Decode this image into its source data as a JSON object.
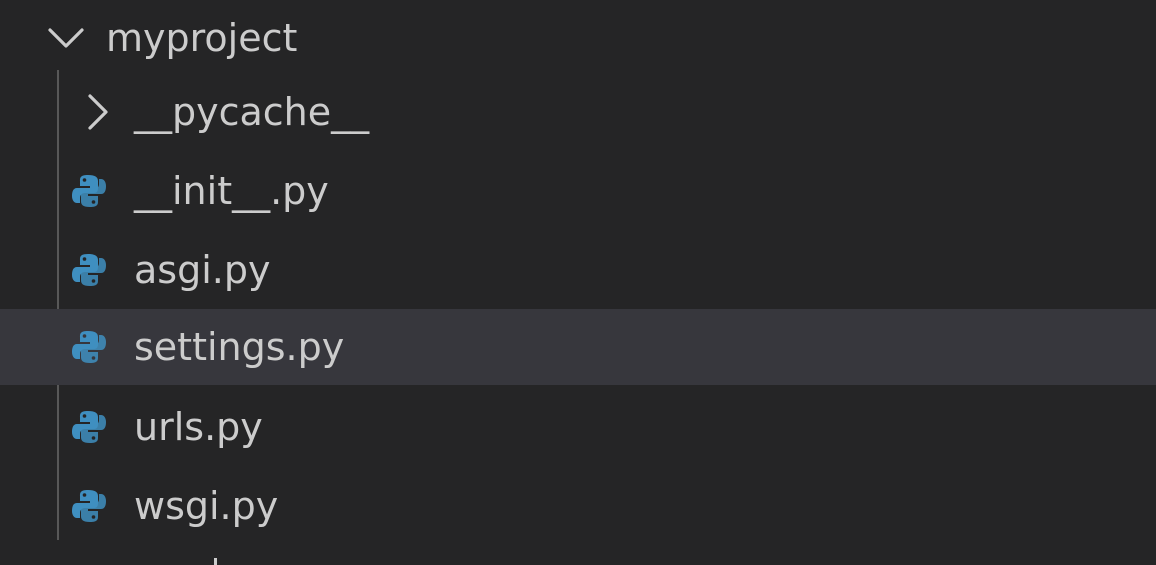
{
  "explorer": {
    "folder": {
      "label": "myproject",
      "icon": "chevron-down-icon"
    },
    "items": [
      {
        "label": "__pycache__",
        "kind": "folder",
        "icon": "chevron-right-icon"
      },
      {
        "label": "__init__.py",
        "kind": "file",
        "icon": "python-icon"
      },
      {
        "label": "asgi.py",
        "kind": "file",
        "icon": "python-icon"
      },
      {
        "label": "settings.py",
        "kind": "file",
        "icon": "python-icon",
        "selected": true
      },
      {
        "label": "urls.py",
        "kind": "file",
        "icon": "python-icon"
      },
      {
        "label": "wsgi.py",
        "kind": "file",
        "icon": "python-icon"
      }
    ]
  },
  "colors": {
    "background": "#252526",
    "selected_row": "#37373d",
    "text": "#cccccc",
    "indent_guide": "#585858",
    "python_icon": "#3f8fc0"
  }
}
